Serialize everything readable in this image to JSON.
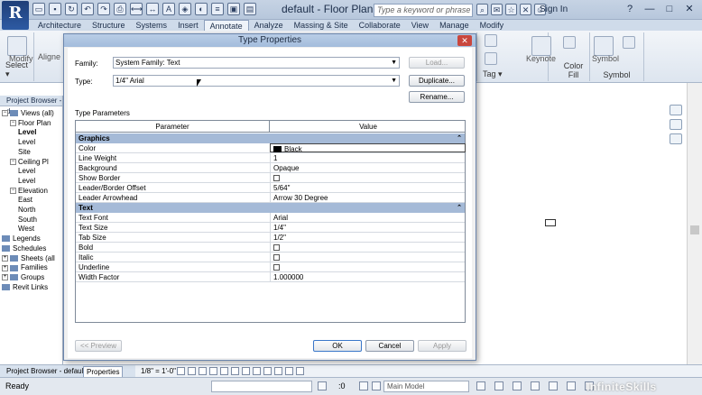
{
  "app": {
    "logo_letter": "R",
    "title": "default - Floor Plan: L...",
    "search_placeholder": "Type a keyword or phrase",
    "sign_in": "Sign In",
    "help": "?",
    "window_buttons": [
      "—",
      "□",
      "✕"
    ]
  },
  "ribbon": {
    "tabs": [
      "Architecture",
      "Structure",
      "Systems",
      "Insert",
      "Annotate",
      "Analyze",
      "Massing & Site",
      "Collaborate",
      "View",
      "Manage",
      "Modify"
    ],
    "active_tab": "Annotate",
    "panels": {
      "modify": "Modify",
      "align": "Aligne",
      "select": "Select ▾",
      "keynote": "Keynote",
      "tag": "Tag ▾",
      "color_fill": "Color Fill",
      "symbol_btn": "Symbol",
      "symbol": "Symbol"
    }
  },
  "project_browser": {
    "title": "Project Browser - d",
    "items": [
      {
        "label": "Views (all)",
        "expander": "−",
        "indent": 0,
        "icon": true
      },
      {
        "label": "Floor Plan",
        "expander": "−",
        "indent": 1,
        "icon": false
      },
      {
        "label": "Level",
        "expander": "",
        "indent": 2,
        "icon": false,
        "bold": true
      },
      {
        "label": "Level",
        "expander": "",
        "indent": 2,
        "icon": false
      },
      {
        "label": "Site",
        "expander": "",
        "indent": 2,
        "icon": false
      },
      {
        "label": "Ceiling Pl",
        "expander": "−",
        "indent": 1,
        "icon": false
      },
      {
        "label": "Level",
        "expander": "",
        "indent": 2,
        "icon": false
      },
      {
        "label": "Level",
        "expander": "",
        "indent": 2,
        "icon": false
      },
      {
        "label": "Elevation",
        "expander": "−",
        "indent": 1,
        "icon": false
      },
      {
        "label": "East",
        "expander": "",
        "indent": 2,
        "icon": false
      },
      {
        "label": "North",
        "expander": "",
        "indent": 2,
        "icon": false
      },
      {
        "label": "South",
        "expander": "",
        "indent": 2,
        "icon": false
      },
      {
        "label": "West",
        "expander": "",
        "indent": 2,
        "icon": false
      },
      {
        "label": "Legends",
        "expander": "",
        "indent": 0,
        "icon": true
      },
      {
        "label": "Schedules",
        "expander": "",
        "indent": 0,
        "icon": true
      },
      {
        "label": "Sheets (all",
        "expander": "+",
        "indent": 0,
        "icon": true
      },
      {
        "label": "Families",
        "expander": "+",
        "indent": 0,
        "icon": true
      },
      {
        "label": "Groups",
        "expander": "+",
        "indent": 0,
        "icon": true
      },
      {
        "label": "Revit Links",
        "expander": "",
        "indent": 0,
        "icon": true
      }
    ]
  },
  "bottom_tabs": {
    "browser": "Project Browser - default",
    "properties": "Properties"
  },
  "view_control": {
    "scale": "1/8\" = 1'-0\""
  },
  "status": {
    "text": "Ready",
    "coord": ":0",
    "workset": "Main Model"
  },
  "dialog": {
    "title": "Type Properties",
    "close": "✕",
    "family_label": "Family:",
    "family_value": "System Family: Text",
    "type_label": "Type:",
    "type_value": "1/4\" Arial",
    "load_button": "Load...",
    "duplicate_button": "Duplicate...",
    "rename_button": "Rename...",
    "type_parameters_label": "Type Parameters",
    "col_parameter": "Parameter",
    "col_value": "Value",
    "groups": [
      {
        "name": "Graphics",
        "rows": [
          {
            "name": "Color",
            "value": "Black",
            "kind": "color"
          },
          {
            "name": "Line Weight",
            "value": "1",
            "kind": "text"
          },
          {
            "name": "Background",
            "value": "Opaque",
            "kind": "text"
          },
          {
            "name": "Show Border",
            "value": "",
            "kind": "check"
          },
          {
            "name": "Leader/Border Offset",
            "value": "5/64\"",
            "kind": "text"
          },
          {
            "name": "Leader Arrowhead",
            "value": "Arrow 30 Degree",
            "kind": "text"
          }
        ]
      },
      {
        "name": "Text",
        "rows": [
          {
            "name": "Text Font",
            "value": "Arial",
            "kind": "text"
          },
          {
            "name": "Text Size",
            "value": "1/4\"",
            "kind": "text"
          },
          {
            "name": "Tab Size",
            "value": "1/2\"",
            "kind": "text"
          },
          {
            "name": "Bold",
            "value": "",
            "kind": "check"
          },
          {
            "name": "Italic",
            "value": "",
            "kind": "check"
          },
          {
            "name": "Underline",
            "value": "",
            "kind": "check"
          },
          {
            "name": "Width Factor",
            "value": "1.000000",
            "kind": "text"
          }
        ]
      }
    ],
    "preview_button": "<< Preview",
    "ok_button": "OK",
    "cancel_button": "Cancel",
    "apply_button": "Apply"
  },
  "watermark": "InfiniteSkills"
}
